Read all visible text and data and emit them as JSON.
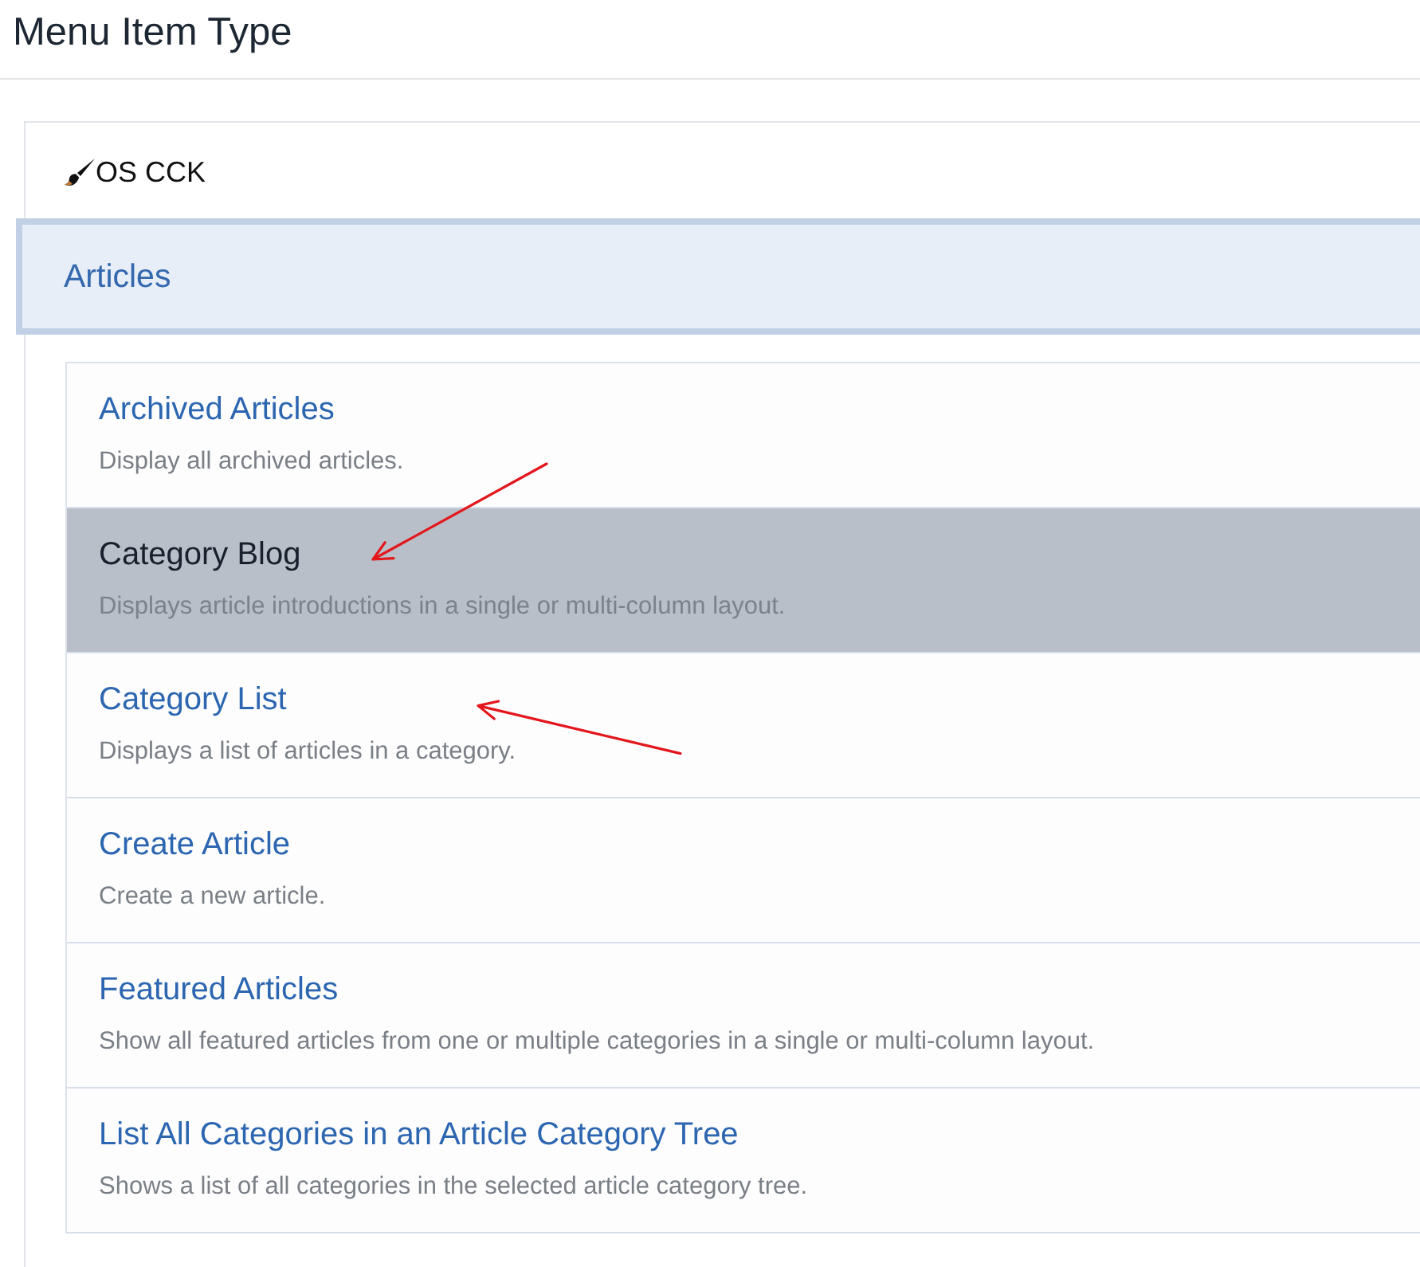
{
  "dialog": {
    "title": "Menu Item Type"
  },
  "component": {
    "name": "OS CCK"
  },
  "group": {
    "label": "Articles",
    "expanded": true
  },
  "items": [
    {
      "title": "Archived Articles",
      "description": "Display all archived articles.",
      "selected": false
    },
    {
      "title": "Category Blog",
      "description": "Displays article introductions in a single or multi-column layout.",
      "selected": true,
      "arrow": {
        "kind": "descending"
      }
    },
    {
      "title": "Category List",
      "description": "Displays a list of articles in a category.",
      "selected": false,
      "arrow": {
        "kind": "ascending"
      }
    },
    {
      "title": "Create Article",
      "description": "Create a new article.",
      "selected": false
    },
    {
      "title": "Featured Articles",
      "description": "Show all featured articles from one or multiple categories in a single or multi-column layout.",
      "selected": false
    },
    {
      "title": "List All Categories in an Article Category Tree",
      "description": "Shows a list of all categories in the selected article category tree.",
      "selected": false
    }
  ]
}
